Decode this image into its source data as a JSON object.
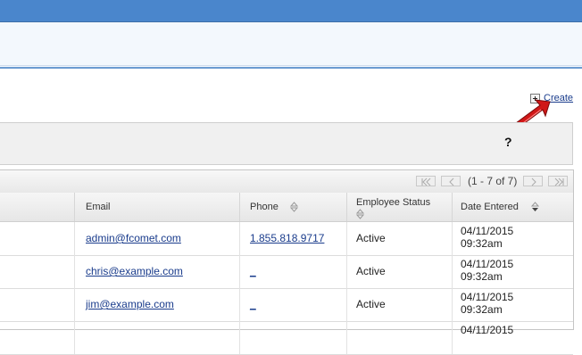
{
  "toolbar": {
    "create_label": "Create"
  },
  "filter": {
    "help_label": "?"
  },
  "pager": {
    "info": "(1 - 7 of 7)"
  },
  "columns": {
    "email": "Email",
    "phone": "Phone",
    "status_line1": "Employee Status",
    "date": "Date Entered"
  },
  "rows": [
    {
      "email": "admin@fcomet.com",
      "phone": "1.855.818.9717",
      "status": "Active",
      "date": "04/11/2015",
      "time": "09:32am"
    },
    {
      "email": "chris@example.com",
      "phone": "_",
      "status": "Active",
      "date": "04/11/2015",
      "time": "09:32am"
    },
    {
      "email": "jim@example.com",
      "phone": "_",
      "status": "Active",
      "date": "04/11/2015",
      "time": "09:32am"
    },
    {
      "email": "",
      "phone": "",
      "status": "",
      "date": "04/11/2015",
      "time": ""
    }
  ],
  "colors": {
    "topbar": "#4a86cc",
    "link": "#1a3c8c",
    "arrow": "#d01818"
  },
  "icons": [
    "plus-icon",
    "red-arrow-icon",
    "first-page-icon",
    "prev-page-icon",
    "next-page-icon",
    "last-page-icon",
    "sort-icon",
    "sort-desc-icon"
  ]
}
